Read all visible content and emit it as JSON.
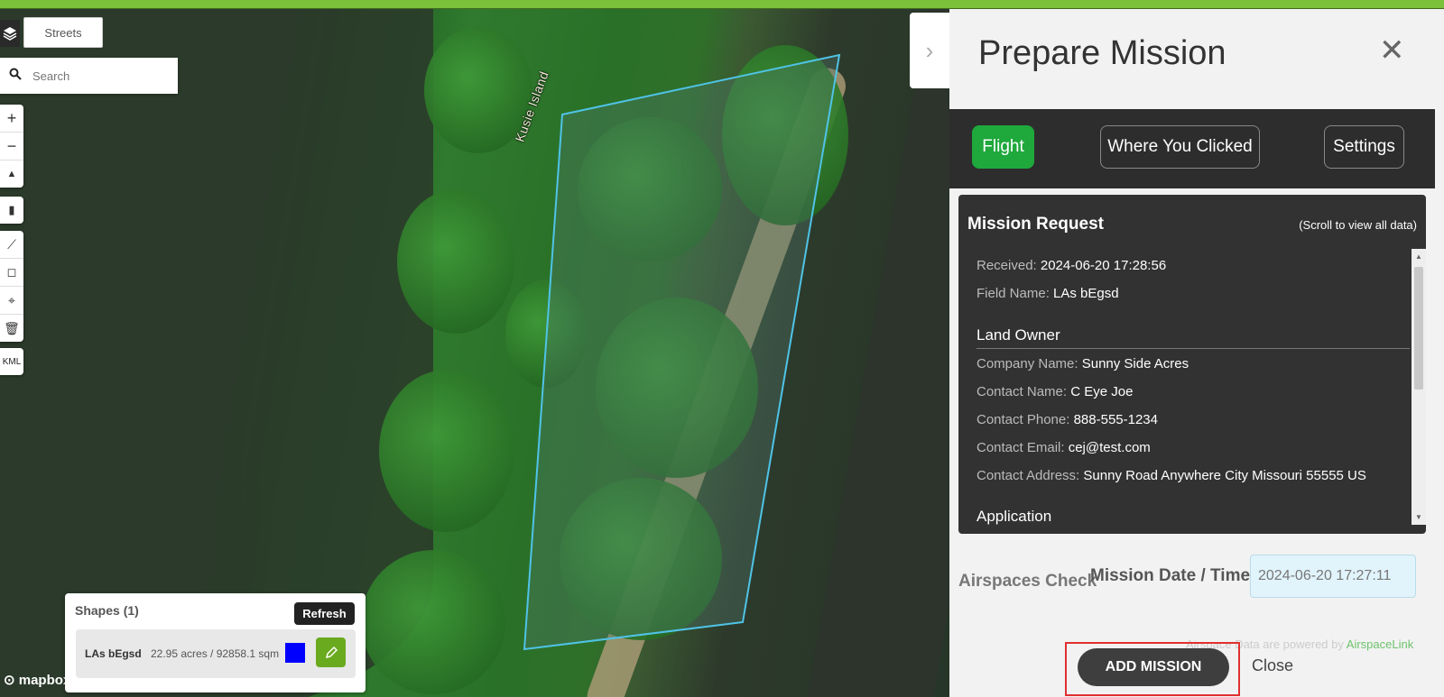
{
  "map": {
    "layer_button_label": "Streets",
    "search_placeholder": "Search",
    "island_label": "Kusie Island",
    "attribution": "mapbox",
    "controls": {
      "kml_label": "KML"
    }
  },
  "shapes": {
    "title": "Shapes (1)",
    "refresh_label": "Refresh",
    "items": [
      {
        "name": "LAs bEgsd",
        "area": "22.95 acres / 92858.1 sqm",
        "color": "#0000ff"
      }
    ]
  },
  "panel": {
    "title": "Prepare Mission",
    "tabs": [
      {
        "label": "Flight",
        "active": true
      },
      {
        "label": "Where You Clicked",
        "active": false
      },
      {
        "label": "Settings",
        "active": false
      }
    ],
    "request": {
      "title": "Mission Request",
      "hint": "(Scroll to view all data)",
      "received_label": "Received:",
      "received_value": "2024-06-20 17:28:56",
      "field_name_label": "Field Name:",
      "field_name_value": "LAs bEgsd",
      "land_owner_heading": "Land Owner",
      "company_label": "Company Name:",
      "company_value": "Sunny Side Acres",
      "contact_name_label": "Contact Name:",
      "contact_name_value": "C Eye Joe",
      "phone_label": "Contact Phone:",
      "phone_value": "888-555-1234",
      "email_label": "Contact Email:",
      "email_value": "cej@test.com",
      "address_label": "Contact Address:",
      "address_value": "Sunny Road Anywhere City Missouri 55555 US",
      "application_heading": "Application"
    },
    "airspaces_label": "Airspaces Check",
    "date_label": "Mission Date / Time",
    "date_value": "2024-06-20 17:27:11",
    "powered_prefix": "Airspace Data are powered by ",
    "powered_brand": "AirspaceLink",
    "add_mission_label": "ADD MISSION",
    "close_label": "Close"
  },
  "colors": {
    "accent_green": "#1fa83c",
    "highlight_red": "#e03030",
    "polygon_stroke": "#4fc3e6"
  }
}
